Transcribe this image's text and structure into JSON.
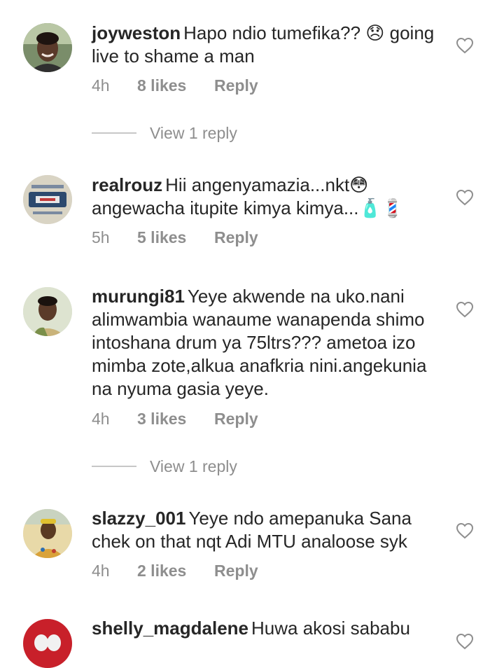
{
  "comments": [
    {
      "username": "joyweston",
      "text": "Hapo ndio tumefika?? 😞 going live to shame a man",
      "time": "4h",
      "likes": "8 likes",
      "reply": "Reply",
      "view_replies": "View 1 reply",
      "avatar": "avatar-woman-photo"
    },
    {
      "username": "realrouz",
      "text": "Hii angenyamazia...nkt😳 angewacha itupite kimya kimya...🧴💈",
      "time": "5h",
      "likes": "5 likes",
      "reply": "Reply",
      "avatar": "avatar-truth-logo"
    },
    {
      "username": "murungi81",
      "text": "Yeye akwende na uko.nani alimwambia wanaume wanapenda shimo intoshana drum ya 75ltrs??? ametoa izo mimba zote,alkua anafkria nini.angekunia na nyuma gasia yeye.",
      "time": "4h",
      "likes": "3 likes",
      "reply": "Reply",
      "view_replies": "View 1 reply",
      "avatar": "avatar-woman-photo"
    },
    {
      "username": "slazzy_001",
      "text": "Yeye ndo amepanuka Sana chek on that nqt Adi MTU analoose syk",
      "time": "4h",
      "likes": "2 likes",
      "reply": "Reply",
      "avatar": "avatar-man-photo"
    },
    {
      "username": "shelly_magdalene",
      "text": "Huwa akosi sababu",
      "avatar": "avatar-red-photo"
    }
  ],
  "colors": {
    "text": "#262626",
    "secondary": "#8e8e8e",
    "divider": "#c7c7c7",
    "background": "#ffffff"
  },
  "icons": {
    "like": "heart-outline-icon"
  }
}
